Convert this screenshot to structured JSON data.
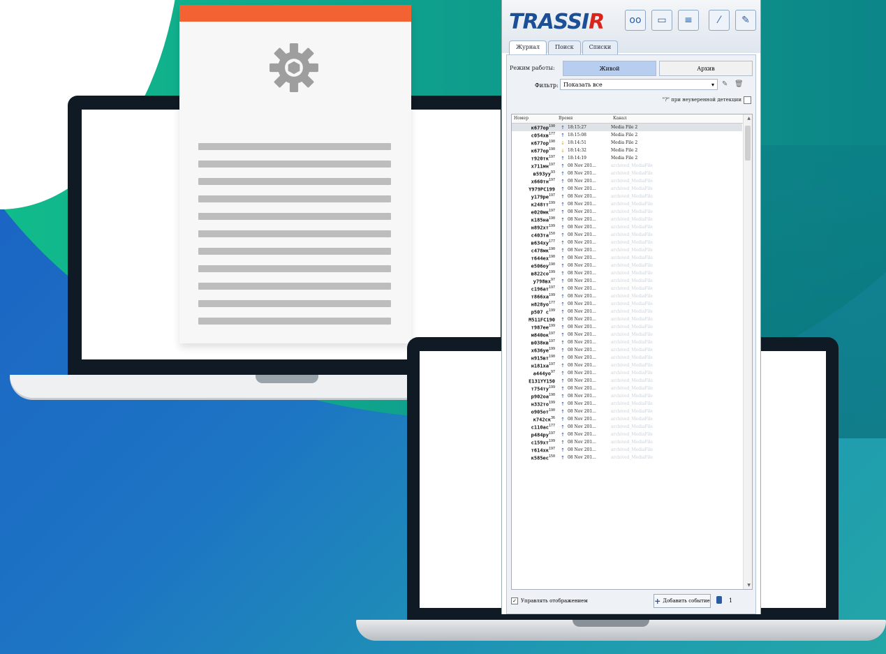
{
  "app": {
    "logo_main": "TRASSI",
    "logo_accent": "R"
  },
  "toolbar": [
    {
      "name": "glasses-icon",
      "glyph": "oo"
    },
    {
      "name": "monitor-icon",
      "glyph": "▭"
    },
    {
      "name": "layout-icon",
      "glyph": "≡"
    },
    {
      "name": "wand-icon",
      "glyph": "⁄"
    },
    {
      "name": "edit-icon",
      "glyph": "✎"
    }
  ],
  "tabs": [
    "Журнал",
    "Поиск",
    "Списки"
  ],
  "mode": {
    "label": "Режим работы:",
    "live": "Живой",
    "archive": "Архив"
  },
  "filter": {
    "label": "Фильтр:",
    "value": "Показать все"
  },
  "question_label": "\"?\" при неуверенной детекции",
  "columns": [
    "Номер",
    "Время",
    "Канал"
  ],
  "rows": [
    {
      "num": "к677ор",
      "reg": "190",
      "dir": "up",
      "time": "18:15:27",
      "chan": "Media File 2",
      "sel": true
    },
    {
      "num": "с054хв",
      "reg": "177",
      "dir": "up",
      "time": "18:15:08",
      "chan": "Media File 2"
    },
    {
      "num": "к677ор",
      "reg": "190",
      "dir": "down",
      "time": "18:14:51",
      "chan": "Media File 2"
    },
    {
      "num": "к677ор",
      "reg": "190",
      "dir": "down",
      "time": "18:14:32",
      "chan": "Media File 2"
    },
    {
      "num": "т920тк",
      "reg": "197",
      "dir": "up",
      "time": "18:14:19",
      "chan": "Media File 2"
    },
    {
      "num": "х711мн",
      "reg": "197",
      "dir": "up",
      "time": "08 Nov 201...",
      "chan": "archived_MediaFile",
      "dim": true
    },
    {
      "num": "в593уу",
      "reg": "93",
      "dir": "up",
      "time": "08 Nov 201...",
      "chan": "archived_MediaFile",
      "dim": true
    },
    {
      "num": "х660тн",
      "reg": "197",
      "dir": "up",
      "time": "08 Nov 201...",
      "chan": "archived_MediaFile",
      "dim": true
    },
    {
      "num": "Y979PC199",
      "reg": "",
      "dir": "up",
      "time": "08 Nov 201...",
      "chan": "archived_MediaFile",
      "dim": true
    },
    {
      "num": "у179ре",
      "reg": "197",
      "dir": "up",
      "time": "08 Nov 201...",
      "chan": "archived_MediaFile",
      "dim": true
    },
    {
      "num": "к248тт",
      "reg": "199",
      "dir": "up",
      "time": "08 Nov 201...",
      "chan": "archived_MediaFile",
      "dim": true
    },
    {
      "num": "е020мк",
      "reg": "197",
      "dir": "up",
      "time": "08 Nov 201...",
      "chan": "archived_MediaFile",
      "dim": true
    },
    {
      "num": "к185на",
      "reg": "190",
      "dir": "up",
      "time": "08 Nov 201...",
      "chan": "archived_MediaFile",
      "dim": true
    },
    {
      "num": "н892хт",
      "reg": "199",
      "dir": "up",
      "time": "08 Nov 201...",
      "chan": "archived_MediaFile",
      "dim": true
    },
    {
      "num": "с403та",
      "reg": "150",
      "dir": "up",
      "time": "08 Nov 201...",
      "chan": "archived_MediaFile",
      "dim": true
    },
    {
      "num": "в634ху",
      "reg": "177",
      "dir": "up",
      "time": "08 Nov 201...",
      "chan": "archived_MediaFile",
      "dim": true
    },
    {
      "num": "с478мк",
      "reg": "190",
      "dir": "up",
      "time": "08 Nov 201...",
      "chan": "archived_MediaFile",
      "dim": true
    },
    {
      "num": "т644ех",
      "reg": "190",
      "dir": "up",
      "time": "08 Nov 201...",
      "chan": "archived_MediaFile",
      "dim": true
    },
    {
      "num": "е506оу",
      "reg": "190",
      "dir": "up",
      "time": "08 Nov 201...",
      "chan": "archived_MediaFile",
      "dim": true
    },
    {
      "num": "в822со",
      "reg": "199",
      "dir": "up",
      "time": "08 Nov 201...",
      "chan": "archived_MediaFile",
      "dim": true
    },
    {
      "num": "у798вх",
      "reg": "97",
      "dir": "up",
      "time": "08 Nov 201...",
      "chan": "archived_MediaFile",
      "dim": true
    },
    {
      "num": "с196ат",
      "reg": "197",
      "dir": "up",
      "time": "08 Nov 201...",
      "chan": "archived_MediaFile",
      "dim": true
    },
    {
      "num": "т866ха",
      "reg": "199",
      "dir": "up",
      "time": "08 Nov 201...",
      "chan": "archived_MediaFile",
      "dim": true
    },
    {
      "num": "н828уо",
      "reg": "177",
      "dir": "up",
      "time": "08 Nov 201...",
      "chan": "archived_MediaFile",
      "dim": true
    },
    {
      "num": "р507 с",
      "reg": "199",
      "dir": "up",
      "time": "08 Nov 201...",
      "chan": "archived_MediaFile",
      "dim": true
    },
    {
      "num": "M511FC190",
      "reg": "",
      "dir": "up",
      "time": "08 Nov 201...",
      "chan": "archived_MediaFile",
      "dim": true
    },
    {
      "num": "т987ее",
      "reg": "199",
      "dir": "up",
      "time": "08 Nov 201...",
      "chan": "archived_MediaFile",
      "dim": true
    },
    {
      "num": "м840ок",
      "reg": "197",
      "dir": "up",
      "time": "08 Nov 201...",
      "chan": "archived_MediaFile",
      "dim": true
    },
    {
      "num": "в038кв",
      "reg": "197",
      "dir": "up",
      "time": "08 Nov 201...",
      "chan": "archived_MediaFile",
      "dim": true
    },
    {
      "num": "х636уе",
      "reg": "199",
      "dir": "up",
      "time": "08 Nov 201...",
      "chan": "archived_MediaFile",
      "dim": true
    },
    {
      "num": "н915вт",
      "reg": "190",
      "dir": "up",
      "time": "08 Nov 201...",
      "chan": "archived_MediaFile",
      "dim": true
    },
    {
      "num": "н181ха",
      "reg": "197",
      "dir": "up",
      "time": "08 Nov 201...",
      "chan": "archived_MediaFile",
      "dim": true
    },
    {
      "num": "а444уо",
      "reg": "97",
      "dir": "up",
      "time": "08 Nov 201...",
      "chan": "archived_MediaFile",
      "dim": true
    },
    {
      "num": "E131YY150",
      "reg": "",
      "dir": "up",
      "time": "08 Nov 201...",
      "chan": "archived_MediaFile",
      "dim": true
    },
    {
      "num": "т754ту",
      "reg": "199",
      "dir": "up",
      "time": "08 Nov 201...",
      "chan": "archived_MediaFile",
      "dim": true
    },
    {
      "num": "р902оа",
      "reg": "190",
      "dir": "up",
      "time": "08 Nov 201...",
      "chan": "archived_MediaFile",
      "dim": true
    },
    {
      "num": "н332то",
      "reg": "199",
      "dir": "up",
      "time": "08 Nov 201...",
      "chan": "archived_MediaFile",
      "dim": true
    },
    {
      "num": "о905от",
      "reg": "190",
      "dir": "up",
      "time": "08 Nov 201...",
      "chan": "archived_MediaFile",
      "dim": true
    },
    {
      "num": "к742ск",
      "reg": "36",
      "dir": "up",
      "time": "08 Nov 201...",
      "chan": "archived_MediaFile",
      "dim": true
    },
    {
      "num": "с110ас",
      "reg": "177",
      "dir": "up",
      "time": "08 Nov 201...",
      "chan": "archived_MediaFile",
      "dim": true
    },
    {
      "num": "р484ру",
      "reg": "197",
      "dir": "up",
      "time": "08 Nov 201...",
      "chan": "archived_MediaFile",
      "dim": true
    },
    {
      "num": "с159хт",
      "reg": "199",
      "dir": "up",
      "time": "08 Nov 201...",
      "chan": "archived_MediaFile",
      "dim": true
    },
    {
      "num": "т614хк",
      "reg": "197",
      "dir": "up",
      "time": "08 Nov 201...",
      "chan": "archived_MediaFile",
      "dim": true
    },
    {
      "num": "к585ес",
      "reg": "150",
      "dir": "up",
      "time": "08 Nov 201...",
      "chan": "archived_MediaFile",
      "dim": true
    }
  ],
  "bottom": {
    "manage_label": "Управлять отображением",
    "add_label": "Добавить событие",
    "count": "1"
  }
}
